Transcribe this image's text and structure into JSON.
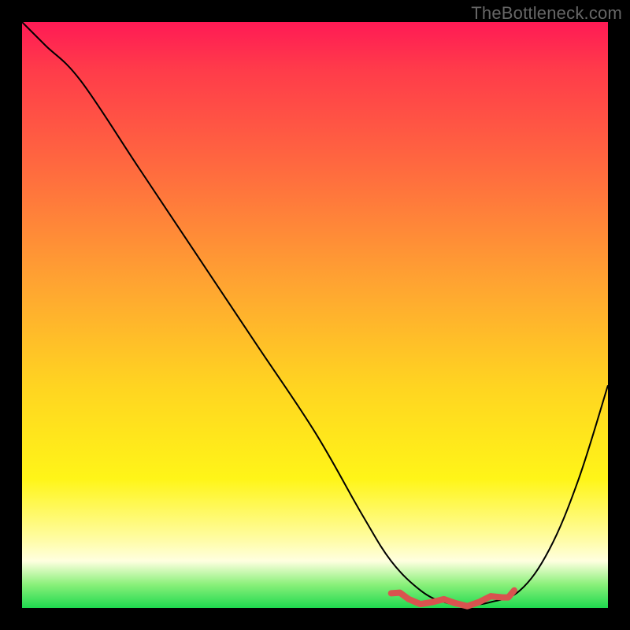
{
  "watermark": "TheBottleneck.com",
  "chart_data": {
    "type": "line",
    "title": "",
    "xlabel": "",
    "ylabel": "",
    "xlim": [
      0,
      100
    ],
    "ylim": [
      0,
      100
    ],
    "grid": false,
    "legend": false,
    "series": [
      {
        "name": "bottleneck-curve",
        "x": [
          0,
          4,
          10,
          20,
          30,
          40,
          50,
          58,
          63,
          68,
          72,
          76,
          80,
          85,
          90,
          95,
          100
        ],
        "y": [
          100,
          96,
          90,
          75,
          60,
          45,
          30,
          16,
          8,
          3,
          1,
          0.5,
          1,
          3,
          10,
          22,
          38
        ],
        "color": "#000000"
      },
      {
        "name": "optimal-zone",
        "x": [
          63,
          66,
          70,
          74,
          78,
          82,
          84
        ],
        "y": [
          2.5,
          1.5,
          1,
          0.8,
          1,
          1.8,
          3
        ],
        "color": "#d9534f"
      }
    ],
    "gradient_stops": [
      {
        "pos": 0.0,
        "color": "#ff1a55"
      },
      {
        "pos": 0.25,
        "color": "#ff6a3f"
      },
      {
        "pos": 0.62,
        "color": "#ffd421"
      },
      {
        "pos": 0.88,
        "color": "#fffca0"
      },
      {
        "pos": 0.96,
        "color": "#8af07a"
      },
      {
        "pos": 1.0,
        "color": "#1fd94f"
      }
    ]
  }
}
